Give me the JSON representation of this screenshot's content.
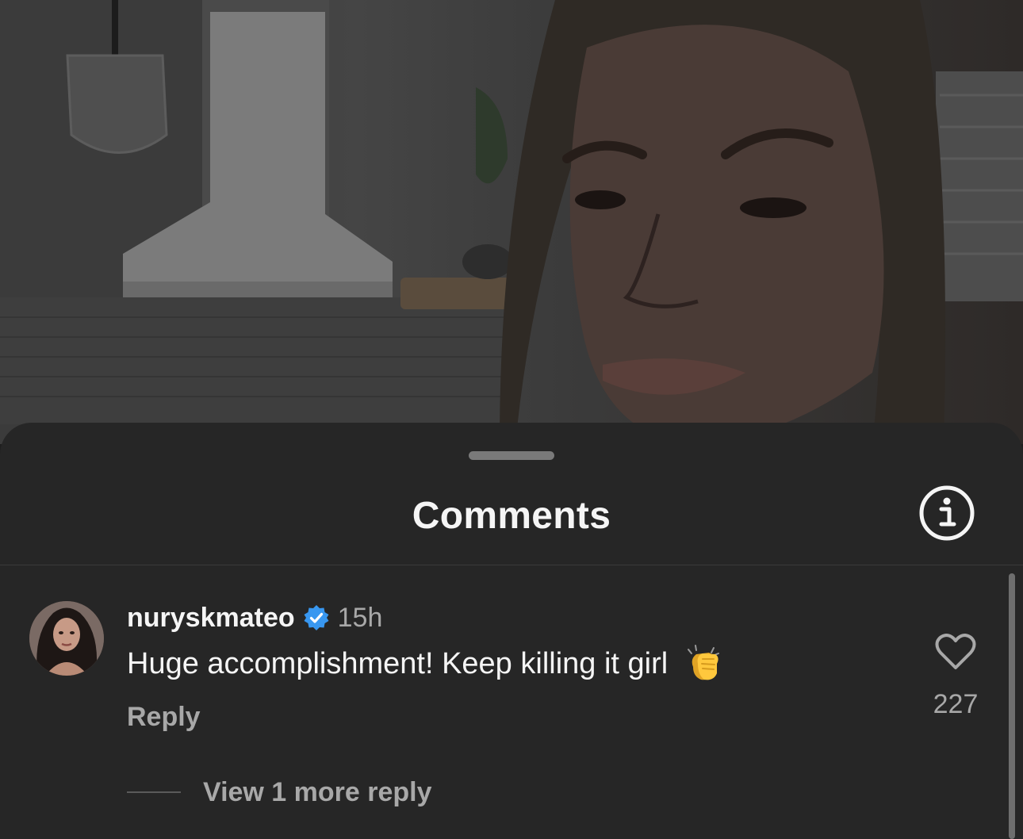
{
  "sheet": {
    "title": "Comments",
    "info_icon": "info-icon"
  },
  "comment": {
    "username": "nuryskmateo",
    "verified_icon": "verified-badge-icon",
    "timestamp": "15h",
    "text": "Huge accomplishment! Keep killing it girl",
    "emoji_icon": "clapping-hands-emoji",
    "reply_label": "Reply",
    "like_icon": "heart-icon",
    "like_count": "227",
    "view_replies_label": "View 1 more reply"
  },
  "colors": {
    "sheet_background": "#262626",
    "primary_text": "#f5f5f5",
    "secondary_text": "#a8a8a8",
    "verified_blue": "#3897f0"
  }
}
